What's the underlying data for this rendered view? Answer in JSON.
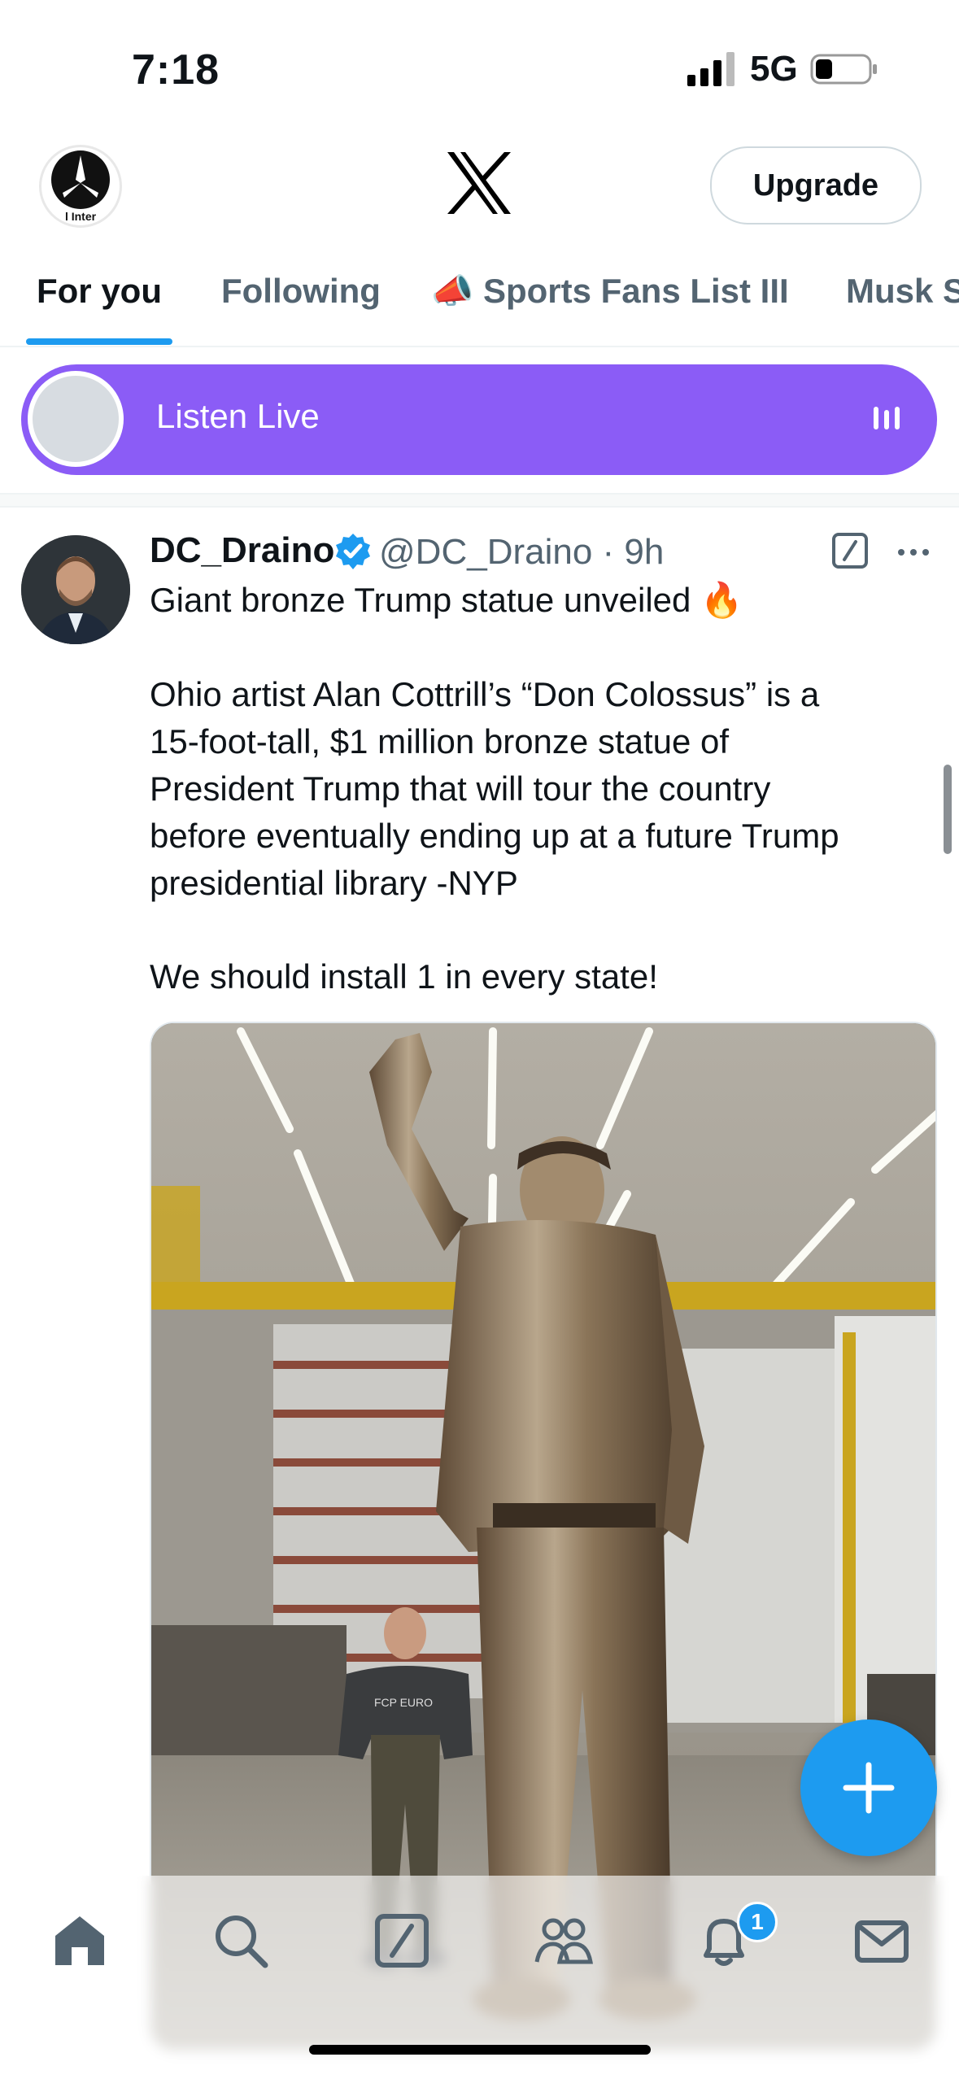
{
  "status_bar": {
    "time": "7:18",
    "network": "5G"
  },
  "header": {
    "upgrade_label": "Upgrade",
    "avatar_text": "l Inter"
  },
  "tabs": [
    {
      "label": "For you",
      "active": true
    },
    {
      "label": "Following",
      "active": false
    },
    {
      "label": "📣 Sports Fans List III",
      "active": false
    },
    {
      "label": "Musk S",
      "active": false
    }
  ],
  "listen_live": {
    "label": "Listen Live",
    "color": "#8b5cf6"
  },
  "tweet": {
    "author_name": "DC_Draino",
    "handle_time": "@DC_Draino · 9h",
    "lines": [
      "Giant bronze Trump statue unveiled 🔥",
      "Ohio artist Alan Cottrill’s “Don Colossus” is a",
      "15-foot-tall, $1 million bronze statue of",
      "President Trump that will tour the country",
      "before eventually ending up at a future Trump",
      "presidential library -NYP",
      "We should install 1 in every state!"
    ],
    "media_shirt_text": "FCP EURO"
  },
  "fab": {
    "icon": "plus-icon"
  },
  "bottom_nav": {
    "items": [
      "home-icon",
      "search-icon",
      "grok-icon",
      "communities-icon",
      "notifications-icon",
      "messages-icon"
    ],
    "notification_count": "1"
  },
  "colors": {
    "accent": "#1d9bf0",
    "text": "#0f1419",
    "muted": "#536471"
  }
}
